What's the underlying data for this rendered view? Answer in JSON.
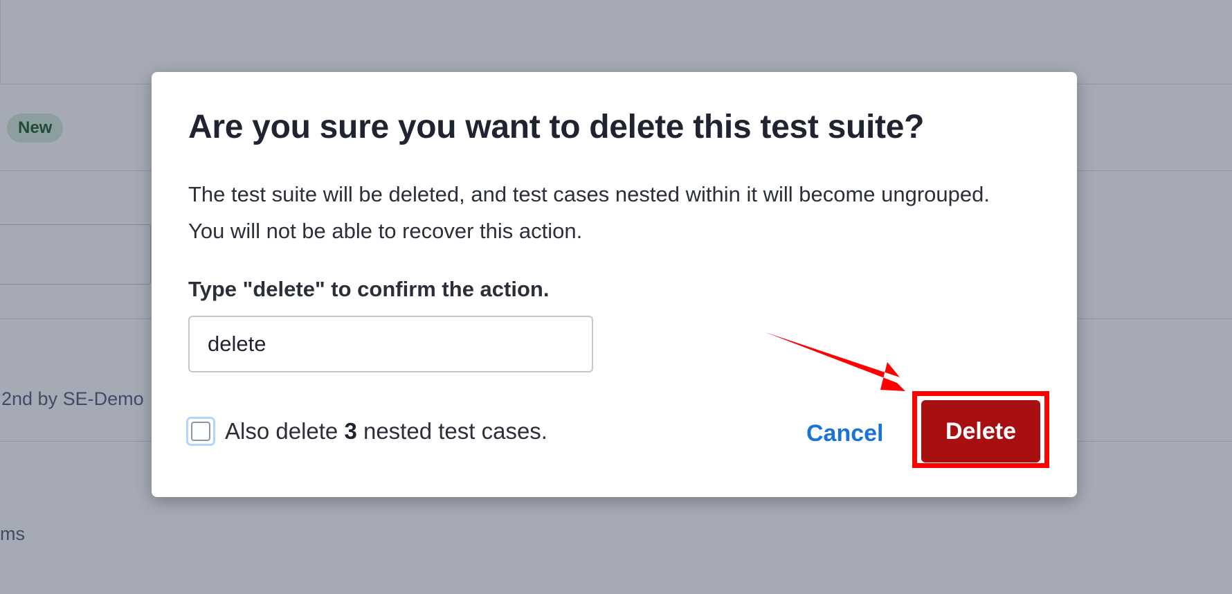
{
  "background": {
    "badge_label": "New",
    "fragment_1": "2nd by SE-Demo",
    "fragment_2": "ms"
  },
  "dialog": {
    "title": "Are you sure you want to delete this test suite?",
    "description": "The test suite will be deleted, and test cases nested within it will become ungrouped. You will not be able to recover this action.",
    "confirm_label": "Type \"delete\" to confirm the action.",
    "confirm_value": "delete",
    "checkbox": {
      "checked": false,
      "label_prefix": "Also delete ",
      "count": "3",
      "label_suffix": " nested test cases."
    },
    "cancel_label": "Cancel",
    "delete_label": "Delete"
  },
  "colors": {
    "delete_button": "#a80f10",
    "cancel_link": "#1a73d9",
    "annotation": "#ff0000",
    "badge_bg": "#d7ecd9"
  }
}
